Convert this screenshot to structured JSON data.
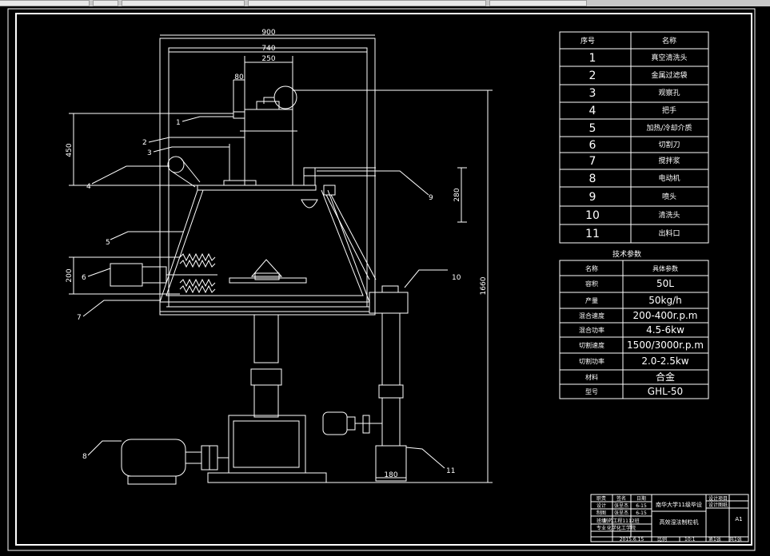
{
  "dimensions": {
    "d900": "900",
    "d740": "740",
    "d250": "250",
    "d80": "80",
    "d450": "450",
    "d280": "280",
    "d200": "200",
    "d1660": "1660",
    "d180": "180"
  },
  "callouts": [
    "1",
    "2",
    "3",
    "4",
    "5",
    "6",
    "7",
    "8",
    "9",
    "10",
    "11"
  ],
  "parts_table": {
    "headers": [
      "序号",
      "名称"
    ],
    "rows": [
      {
        "no": "1",
        "name": "真空清洗头"
      },
      {
        "no": "2",
        "name": "金属过滤袋"
      },
      {
        "no": "3",
        "name": "观察孔"
      },
      {
        "no": "4",
        "name": "把手"
      },
      {
        "no": "5",
        "name": "加热/冷却介质"
      },
      {
        "no": "6",
        "name": "切割刀"
      },
      {
        "no": "7",
        "name": "搅拌浆"
      },
      {
        "no": "8",
        "name": "电动机"
      },
      {
        "no": "9",
        "name": "喷头"
      },
      {
        "no": "10",
        "name": "清洗头"
      },
      {
        "no": "11",
        "name": "出料口"
      }
    ]
  },
  "spec_table": {
    "title": "技术参数",
    "headers": [
      "名称",
      "具体参数"
    ],
    "rows": [
      {
        "name": "容积",
        "value": "50L"
      },
      {
        "name": "产量",
        "value": "50kg/h"
      },
      {
        "name": "混合速度",
        "value": "200-400r.p.m"
      },
      {
        "name": "混合功率",
        "value": "4.5-6kw"
      },
      {
        "name": "切割速度",
        "value": "1500/3000r.p.m"
      },
      {
        "name": "切割功率",
        "value": "2.0-2.5kw"
      },
      {
        "name": "材料",
        "value": "合金"
      },
      {
        "name": "型号",
        "value": "GHL-50"
      }
    ]
  },
  "title_block": {
    "rows": [
      [
        "职责",
        "签名",
        "日期"
      ],
      [
        "设计",
        "张呈杰",
        "6-15"
      ],
      [
        "制图",
        "张呈杰",
        "6-15"
      ],
      [
        "班级",
        "制药工程1112班",
        ""
      ],
      [
        "专业",
        "化学化工学院",
        ""
      ]
    ],
    "school": "南华大学11级毕设",
    "drawing_name": "高效湿法制粒机",
    "date": "2015.6.15",
    "scale_label": "比例",
    "scale": "10:1",
    "sheet": "第1张",
    "sheets_total": "共1张",
    "size": "A1",
    "right_labels": [
      "设计项目",
      "设计图纸"
    ]
  }
}
